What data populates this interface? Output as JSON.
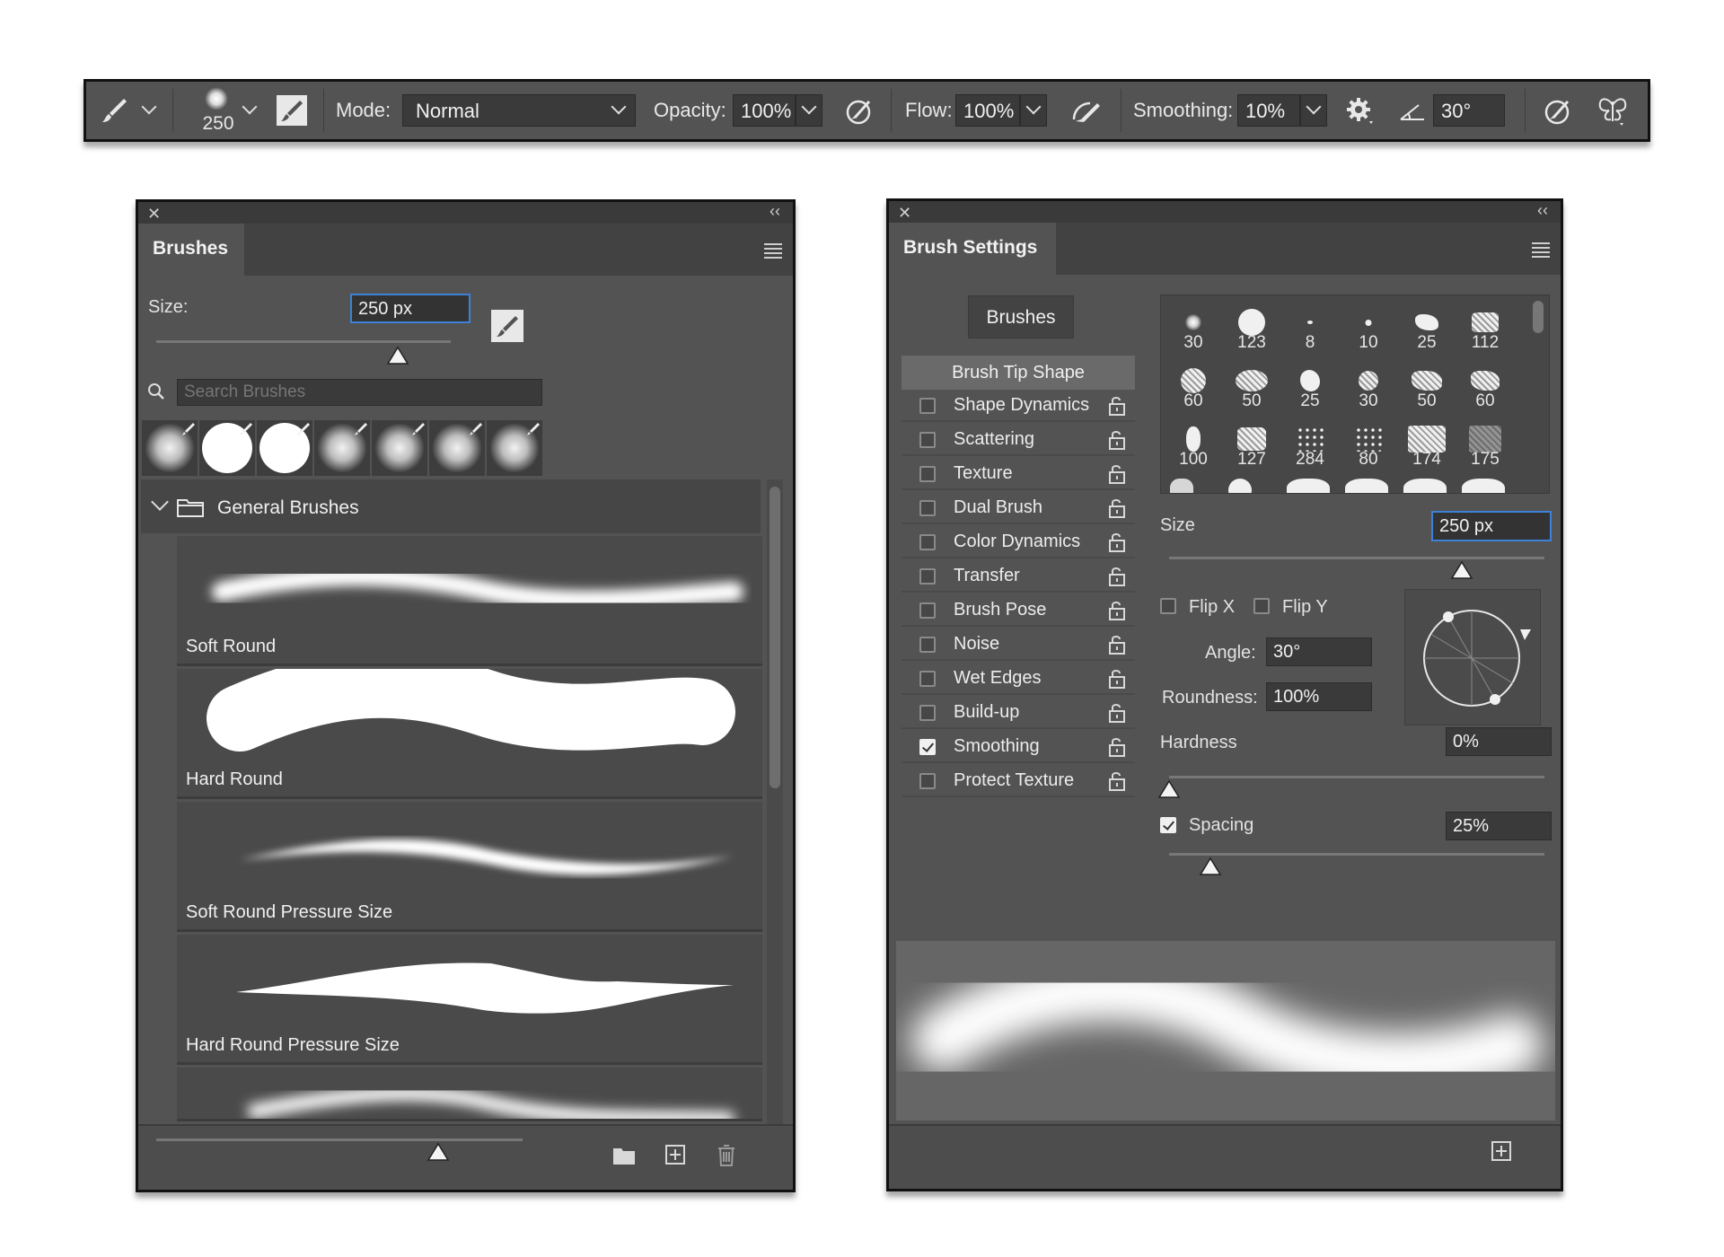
{
  "optionsBar": {
    "brushSize": "250",
    "modeLabel": "Mode:",
    "modeValue": "Normal",
    "opacityLabel": "Opacity:",
    "opacityValue": "100%",
    "flowLabel": "Flow:",
    "flowValue": "100%",
    "smoothingLabel": "Smoothing:",
    "smoothingValue": "10%",
    "angleValue": "30°"
  },
  "brushesPanel": {
    "tab": "Brushes",
    "sizeLabel": "Size:",
    "sizeValue": "250 px",
    "sizeSlider": 0.82,
    "searchPlaceholder": "Search Brushes",
    "groupName": "General Brushes",
    "brushes": [
      {
        "name": "Soft Round"
      },
      {
        "name": "Hard Round"
      },
      {
        "name": "Soft Round Pressure Size"
      },
      {
        "name": "Hard Round Pressure Size"
      }
    ],
    "previewSlider": 0.77
  },
  "brushSettingsPanel": {
    "tab": "Brush Settings",
    "brushesButton": "Brushes",
    "tipShape": "Brush Tip Shape",
    "options": [
      {
        "label": "Shape Dynamics",
        "checked": false
      },
      {
        "label": "Scattering",
        "checked": false
      },
      {
        "label": "Texture",
        "checked": false
      },
      {
        "label": "Dual Brush",
        "checked": false
      },
      {
        "label": "Color Dynamics",
        "checked": false
      },
      {
        "label": "Transfer",
        "checked": false
      },
      {
        "label": "Brush Pose",
        "checked": false
      },
      {
        "label": "Noise",
        "checked": false
      },
      {
        "label": "Wet Edges",
        "checked": false
      },
      {
        "label": "Build-up",
        "checked": false
      },
      {
        "label": "Smoothing",
        "checked": true
      },
      {
        "label": "Protect Texture",
        "checked": false
      }
    ],
    "tipSizes": [
      "30",
      "123",
      "8",
      "10",
      "25",
      "112",
      "60",
      "50",
      "25",
      "30",
      "50",
      "60",
      "100",
      "127",
      "284",
      "80",
      "174",
      "175"
    ],
    "sizeLabel": "Size",
    "sizeValue": "250 px",
    "sizeSlider": 0.78,
    "flipX": "Flip X",
    "flipY": "Flip Y",
    "angleLabel": "Angle:",
    "angleValue": "30°",
    "roundnessLabel": "Roundness:",
    "roundnessValue": "100%",
    "hardnessLabel": "Hardness",
    "hardnessValue": "0%",
    "hardnessSlider": 0.0,
    "spacingLabel": "Spacing",
    "spacingValue": "25%",
    "spacingChecked": true,
    "spacingSlider": 0.11
  },
  "colors": {
    "panelBg": "#535353",
    "darkStrip": "#3a3a3a",
    "focusBlue": "#3d82d8"
  }
}
